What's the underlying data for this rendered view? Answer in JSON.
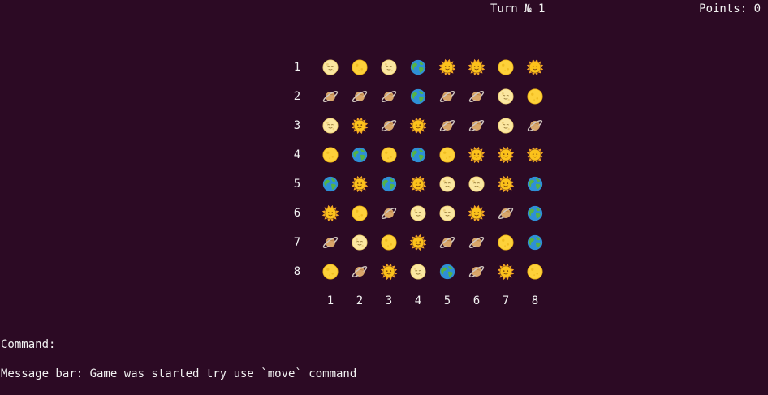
{
  "header": {
    "turn": "Turn № 1",
    "points": "Points: 0"
  },
  "board": {
    "row_labels": [
      "1",
      "2",
      "3",
      "4",
      "5",
      "6",
      "7",
      "8"
    ],
    "col_labels": [
      "1",
      "2",
      "3",
      "4",
      "5",
      "6",
      "7",
      "8"
    ],
    "icon_legend": {
      "s": "sun-with-face-icon",
      "m": "full-moon-face-icon",
      "y": "yellow-moon-icon",
      "e": "earth-globe-icon",
      "p": "ringed-planet-icon"
    },
    "grid": [
      [
        "m",
        "y",
        "m",
        "e",
        "s",
        "s",
        "y",
        "s"
      ],
      [
        "p",
        "p",
        "p",
        "e",
        "p",
        "p",
        "m",
        "y"
      ],
      [
        "m",
        "s",
        "p",
        "s",
        "p",
        "p",
        "m",
        "p"
      ],
      [
        "y",
        "e",
        "y",
        "e",
        "y",
        "s",
        "s",
        "s"
      ],
      [
        "e",
        "s",
        "e",
        "s",
        "m",
        "m",
        "s",
        "e"
      ],
      [
        "s",
        "y",
        "p",
        "m",
        "m",
        "s",
        "p",
        "e"
      ],
      [
        "p",
        "m",
        "y",
        "s",
        "p",
        "p",
        "y",
        "e"
      ],
      [
        "y",
        "p",
        "s",
        "m",
        "e",
        "p",
        "s",
        "y"
      ]
    ]
  },
  "command": {
    "label": "Command:"
  },
  "message_bar": {
    "text": "Message bar: Game was started try use `move` command"
  }
}
